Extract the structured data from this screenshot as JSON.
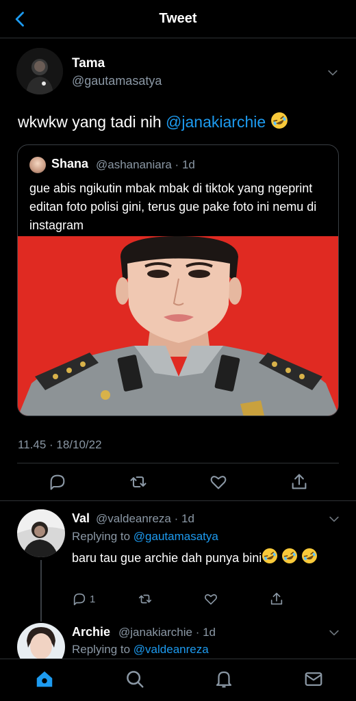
{
  "header": {
    "title": "Tweet",
    "back_icon": "back-chevron-icon"
  },
  "tweet": {
    "author_name": "Tama",
    "author_handle": "@gautamasatya",
    "text_prefix": "wkwkw yang tadi nih",
    "text_mention": "@janakiarchie",
    "text_emoji": "rolling-on-floor-laughing-emoji",
    "timestamp": "11.45 · 18/10/22",
    "quote": {
      "name": "Shana",
      "handle_time": "@ashananiara · 1d",
      "text": "gue abis ngikutin mbak mbak di tiktok yang ngeprint editan foto polisi gini, terus gue pake foto ini nemu di instagram",
      "image": "edited-police-portrait-red-background"
    },
    "actions": [
      "reply-icon",
      "retweet-icon",
      "like-icon",
      "share-icon"
    ]
  },
  "replies": [
    {
      "name": "Val",
      "handle_time": "@valdeanreza · 1d",
      "replying_prefix": "Replying to",
      "replying_handle": "@gautamasatya",
      "text": "baru tau gue archie dah punya bini",
      "reply_count": "1"
    },
    {
      "name": "Archie",
      "handle_time": "@janakiarchie · 1d",
      "replying_prefix": "Replying to",
      "replying_handle": "@valdeanreza"
    }
  ],
  "tabbar": [
    "home-icon",
    "search-icon",
    "notifications-icon",
    "messages-icon"
  ],
  "colors": {
    "accent": "#1d9bf0",
    "muted": "#8b98a5",
    "background": "#000000",
    "photo_background": "#e02a22"
  }
}
